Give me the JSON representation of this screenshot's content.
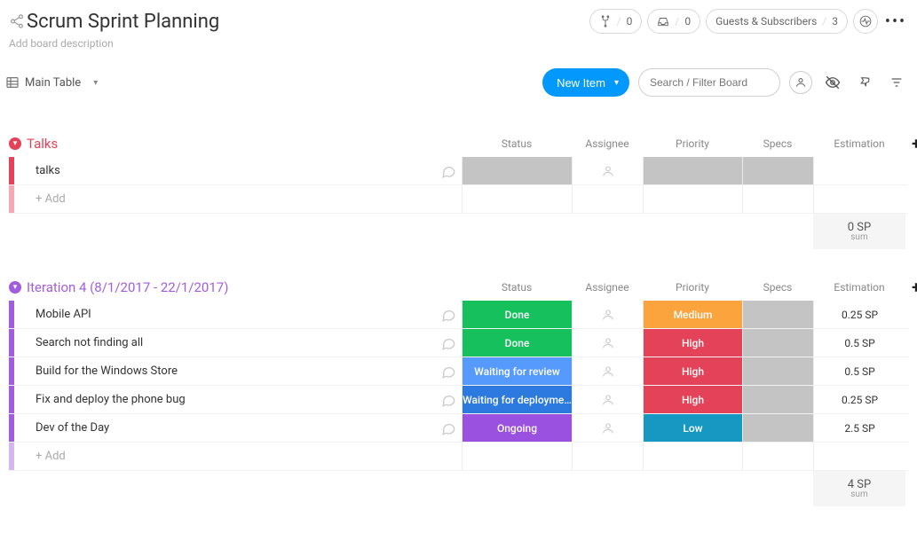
{
  "header": {
    "title": "Scrum Sprint Planning",
    "add_desc": "Add board description",
    "pills": {
      "fork": "0",
      "tray": "0",
      "guests_label": "Guests & Subscribers",
      "guests_count": "3"
    }
  },
  "viewbar": {
    "view_name": "Main Table",
    "new_item": "New Item",
    "search_placeholder": "Search / Filter Board"
  },
  "columns": {
    "status": "Status",
    "assignee": "Assignee",
    "priority": "Priority",
    "specs": "Specs",
    "estimation": "Estimation"
  },
  "groups": [
    {
      "id": "talks",
      "title": "Talks",
      "color": "#e44258",
      "rows": [
        {
          "name": "talks",
          "status": "",
          "status_class": "blank-dark",
          "priority": "",
          "priority_class": "blank-dark",
          "specs_class": "blank-dark",
          "estimation": ""
        }
      ],
      "add_placeholder": "+ Add",
      "sum": {
        "value": "0 SP",
        "label": "sum"
      }
    },
    {
      "id": "iter4",
      "title": "Iteration 4 (8/1/2017 - 22/1/2017)",
      "color": "#a25ddc",
      "rows": [
        {
          "name": "Mobile API",
          "status": "Done",
          "status_class": "st-done",
          "priority": "Medium",
          "priority_class": "pr-medium",
          "specs_class": "blank-dark",
          "estimation": "0.25 SP"
        },
        {
          "name": "Search not finding all",
          "status": "Done",
          "status_class": "st-done",
          "priority": "High",
          "priority_class": "pr-high",
          "specs_class": "blank-dark",
          "estimation": "0.5 SP"
        },
        {
          "name": "Build for the Windows Store",
          "status": "Waiting for review",
          "status_class": "st-review",
          "priority": "High",
          "priority_class": "pr-high",
          "specs_class": "blank-dark",
          "estimation": "0.5 SP"
        },
        {
          "name": "Fix and deploy the phone bug",
          "status": "Waiting for deployme…",
          "status_class": "st-deploy",
          "priority": "High",
          "priority_class": "pr-high",
          "specs_class": "blank-dark",
          "estimation": "0.25 SP"
        },
        {
          "name": "Dev of the Day",
          "status": "Ongoing",
          "status_class": "st-ongoing",
          "priority": "Low",
          "priority_class": "pr-low",
          "specs_class": "blank-dark",
          "estimation": "2.5 SP"
        }
      ],
      "add_placeholder": "+ Add",
      "sum": {
        "value": "4 SP",
        "label": "sum"
      }
    }
  ]
}
